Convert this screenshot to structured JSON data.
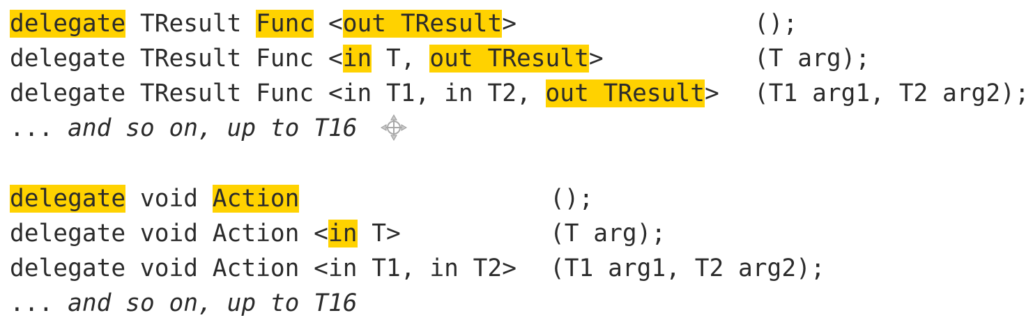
{
  "func_block": {
    "line1": {
      "kw": "delegate",
      "ret": " TResult ",
      "name": "Func",
      "lt": " <",
      "tp1": "out TResult",
      "gt": ">",
      "args": "();"
    },
    "line2": {
      "pre": "delegate TResult Func <",
      "v1": "in",
      "mid": " T, ",
      "v2": "out TResult",
      "gt": ">",
      "args": "(T arg);"
    },
    "line3": {
      "pre": "delegate TResult Func <in T1, in T2, ",
      "v1": "out TResult",
      "gt": ">",
      "args": "(T1 arg1, T2 arg2);"
    },
    "more": {
      "dots": "... ",
      "text": "and so on, up to T16"
    }
  },
  "action_block": {
    "line1": {
      "kw": "delegate",
      "ret": " void ",
      "name": "Action",
      "args": "();"
    },
    "line2": {
      "pre": "delegate void Action <",
      "v1": "in",
      "post": " T>",
      "args": "(T arg);"
    },
    "line3": {
      "pre": "delegate void Action <in T1, in T2>",
      "args": "(T1 arg1, T2 arg2);"
    },
    "more": {
      "dots": "... ",
      "text": "and so on, up to T16"
    }
  },
  "colors": {
    "highlight": "#ffd200",
    "text": "#2b2b2b"
  },
  "icons": {
    "cursor": "move-cursor-icon"
  }
}
